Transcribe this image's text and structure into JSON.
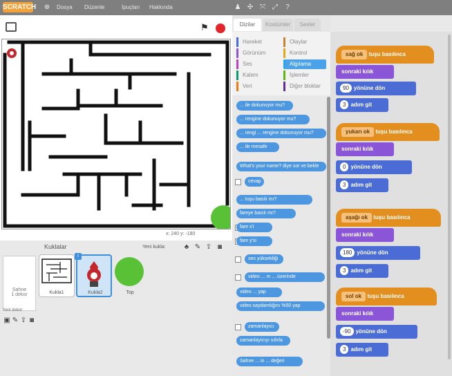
{
  "menubar": {
    "logo": "SCRATCH",
    "items": [
      "Dosya",
      "Düzenle",
      "İpuçları",
      "Hakkında"
    ],
    "icons": [
      "globe-icon",
      "person-icon",
      "move-icon",
      "shrink-icon",
      "expand-icon",
      "help-icon"
    ]
  },
  "stage": {
    "status": "x: 240  y: -180"
  },
  "sprites_pane": {
    "header": "Kuklalar",
    "new_sprite": "Yeni kukla:",
    "stage_label": "Sahne",
    "stage_sub": "1 dekor",
    "new_backdrop": "Yeni dekor:",
    "sprites": [
      {
        "name": "Kukla1",
        "icon": "maze-sprite-icon"
      },
      {
        "name": "Kukla2",
        "icon": "character-sprite-icon"
      },
      {
        "name": "Top",
        "icon": "ball-sprite-icon"
      }
    ]
  },
  "tabs": [
    "Dizilər",
    "Kostümler",
    "Sesler"
  ],
  "categories": [
    {
      "label": "Hareket",
      "color": "#4a6cd4"
    },
    {
      "label": "Görünüm",
      "color": "#8a55d7"
    },
    {
      "label": "Ses",
      "color": "#bb42c3"
    },
    {
      "label": "Kalem",
      "color": "#0e9a6c"
    },
    {
      "label": "Veri",
      "color": "#ee7d16"
    },
    {
      "label": "Olaylar",
      "color": "#c88330"
    },
    {
      "label": "Kontrol",
      "color": "#e1a91a"
    },
    {
      "label": "Algılama",
      "color": "#2ca5e2"
    },
    {
      "label": "İşlemler",
      "color": "#5cb712"
    },
    {
      "label": "Diğer bloklar",
      "color": "#632d99"
    }
  ],
  "palette_blocks": [
    "... ile dokunuyor mu?",
    "... rengine dokunuyor mu?",
    "... rengi ... rengine dokunuyor mu?",
    "... ile mesafe",
    "What's your name? diye sor ve bekle",
    "cevap",
    "... tuşu basılı mı?",
    "fareye basılı mı?",
    "fare x'i",
    "fare y'si",
    "ses yüksekliği",
    "video ... ın ... üzerinde",
    "video ... yap",
    "video saydamlığını %50 yap",
    "zamanlayıcı",
    "zamanlayıcıyı sıfırla",
    "Sahne ... in ... değeri"
  ],
  "scripts": [
    {
      "hat_key": "sağ ok",
      "hat_text": "tuşu basılınca",
      "purple": "sonraki kılık",
      "turn_value": "90",
      "turn_text": "yönüne dön",
      "move_value": "3",
      "move_text": "adım git"
    },
    {
      "hat_key": "yukarı ok",
      "hat_text": "tuşu basılınca",
      "purple": "sonraki kılık",
      "turn_value": "0",
      "turn_text": "yönüne dön",
      "move_value": "3",
      "move_text": "adım git"
    },
    {
      "hat_key": "aşağı ok",
      "hat_text": "tuşu basılınca",
      "purple": "sonraki kılık",
      "turn_value": "180",
      "turn_text": "yönüne dön",
      "move_value": "3",
      "move_text": "adım git"
    },
    {
      "hat_key": "sol ok",
      "hat_text": "tuşu basılınca",
      "purple": "sonraki kılık",
      "turn_value": "-90",
      "turn_text": "yönüne dön",
      "move_value": "3",
      "move_text": "adım git"
    }
  ],
  "colors": {
    "menubar": "#7f7f7f",
    "events": "#e38f1f",
    "looks": "#8a55d7",
    "motion": "#4a6cd4",
    "sensing": "#4d97e0",
    "stop": "#e3262a",
    "ball": "#58c135"
  }
}
